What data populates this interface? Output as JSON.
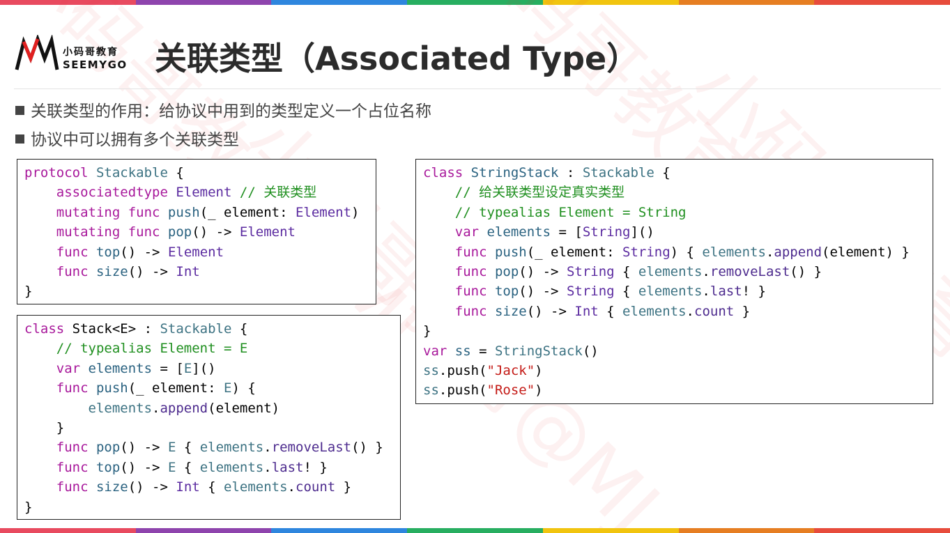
{
  "header": {
    "logo_cn": "小码哥教育",
    "logo_en": "SEEMYGO",
    "title": "关联类型（Associated Type）"
  },
  "bullets": [
    "关联类型的作用：给协议中用到的类型定义一个占位名称",
    "协议中可以拥有多个关联类型"
  ],
  "watermark": "小码哥教育@MJ",
  "colors": {
    "keyword": "#a8189b",
    "type": "#5b2ba0",
    "comment": "#1f8f1f",
    "string": "#c41a16",
    "stripe": [
      "#e84a5f",
      "#8e44ad",
      "#2e86de",
      "#27ae60",
      "#f1c40f",
      "#e67e22",
      "#e74c3c"
    ]
  },
  "code_blocks": {
    "protocol": [
      [
        [
          "protocol ",
          "kw"
        ],
        [
          "Stackable",
          "tn"
        ],
        [
          " {",
          "pl"
        ]
      ],
      [
        [
          "    ",
          "pl"
        ],
        [
          "associatedtype ",
          "kw"
        ],
        [
          "Element",
          "tp"
        ],
        [
          " // 关联类型",
          "cm"
        ]
      ],
      [
        [
          "    ",
          "pl"
        ],
        [
          "mutating func ",
          "kw"
        ],
        [
          "push",
          "fn"
        ],
        [
          "(_ element: ",
          "pl"
        ],
        [
          "Element",
          "tp"
        ],
        [
          ")",
          "pl"
        ]
      ],
      [
        [
          "    ",
          "pl"
        ],
        [
          "mutating func ",
          "kw"
        ],
        [
          "pop",
          "fn"
        ],
        [
          "() -> ",
          "pl"
        ],
        [
          "Element",
          "tp"
        ]
      ],
      [
        [
          "    ",
          "pl"
        ],
        [
          "func ",
          "kw"
        ],
        [
          "top",
          "fn"
        ],
        [
          "() -> ",
          "pl"
        ],
        [
          "Element",
          "tp"
        ]
      ],
      [
        [
          "    ",
          "pl"
        ],
        [
          "func ",
          "kw"
        ],
        [
          "size",
          "fn"
        ],
        [
          "() -> ",
          "pl"
        ],
        [
          "Int",
          "tp"
        ]
      ],
      [
        [
          "}",
          "pl"
        ]
      ]
    ],
    "stack": [
      [
        [
          "class ",
          "kw"
        ],
        [
          "Stack<E>",
          "pl"
        ],
        [
          " : ",
          "pl"
        ],
        [
          "Stackable",
          "tn"
        ],
        [
          " {",
          "pl"
        ]
      ],
      [
        [
          "    // typealias Element = E",
          "cm"
        ]
      ],
      [
        [
          "    ",
          "pl"
        ],
        [
          "var ",
          "kw"
        ],
        [
          "elements",
          "fn"
        ],
        [
          " = [",
          "pl"
        ],
        [
          "E",
          "tn"
        ],
        [
          "]()",
          "pl"
        ]
      ],
      [
        [
          "    ",
          "pl"
        ],
        [
          "func ",
          "kw"
        ],
        [
          "push",
          "fn"
        ],
        [
          "(_ element: ",
          "pl"
        ],
        [
          "E",
          "tn"
        ],
        [
          ") {",
          "pl"
        ]
      ],
      [
        [
          "        ",
          "pl"
        ],
        [
          "elements",
          "tn"
        ],
        [
          ".",
          "pl"
        ],
        [
          "append",
          "mt"
        ],
        [
          "(element)",
          "pl"
        ]
      ],
      [
        [
          "    }",
          "pl"
        ]
      ],
      [
        [
          "    ",
          "pl"
        ],
        [
          "func ",
          "kw"
        ],
        [
          "pop",
          "fn"
        ],
        [
          "() -> ",
          "pl"
        ],
        [
          "E",
          "tn"
        ],
        [
          " { ",
          "pl"
        ],
        [
          "elements",
          "tn"
        ],
        [
          ".",
          "pl"
        ],
        [
          "removeLast",
          "mt"
        ],
        [
          "() }",
          "pl"
        ]
      ],
      [
        [
          "    ",
          "pl"
        ],
        [
          "func ",
          "kw"
        ],
        [
          "top",
          "fn"
        ],
        [
          "() -> ",
          "pl"
        ],
        [
          "E",
          "tn"
        ],
        [
          " { ",
          "pl"
        ],
        [
          "elements",
          "tn"
        ],
        [
          ".",
          "pl"
        ],
        [
          "last",
          "mt"
        ],
        [
          "! }",
          "pl"
        ]
      ],
      [
        [
          "    ",
          "pl"
        ],
        [
          "func ",
          "kw"
        ],
        [
          "size",
          "fn"
        ],
        [
          "() -> ",
          "pl"
        ],
        [
          "Int",
          "tp"
        ],
        [
          " { ",
          "pl"
        ],
        [
          "elements",
          "tn"
        ],
        [
          ".",
          "pl"
        ],
        [
          "count",
          "mt"
        ],
        [
          " }",
          "pl"
        ]
      ],
      [
        [
          "}",
          "pl"
        ]
      ]
    ],
    "stringstack": [
      [
        [
          "class ",
          "kw"
        ],
        [
          "StringStack",
          "fn"
        ],
        [
          " : ",
          "pl"
        ],
        [
          "Stackable",
          "tn"
        ],
        [
          " {",
          "pl"
        ]
      ],
      [
        [
          "    // 给关联类型设定真实类型",
          "cm"
        ]
      ],
      [
        [
          "    // typealias Element = String",
          "cm"
        ]
      ],
      [
        [
          "    ",
          "pl"
        ],
        [
          "var ",
          "kw"
        ],
        [
          "elements",
          "fn"
        ],
        [
          " = [",
          "pl"
        ],
        [
          "String",
          "tp"
        ],
        [
          "]()",
          "pl"
        ]
      ],
      [
        [
          "    ",
          "pl"
        ],
        [
          "func ",
          "kw"
        ],
        [
          "push",
          "fn"
        ],
        [
          "(_ element: ",
          "pl"
        ],
        [
          "String",
          "tp"
        ],
        [
          ") { ",
          "pl"
        ],
        [
          "elements",
          "tn"
        ],
        [
          ".",
          "pl"
        ],
        [
          "append",
          "mt"
        ],
        [
          "(element) }",
          "pl"
        ]
      ],
      [
        [
          "    ",
          "pl"
        ],
        [
          "func ",
          "kw"
        ],
        [
          "pop",
          "fn"
        ],
        [
          "() -> ",
          "pl"
        ],
        [
          "String",
          "tp"
        ],
        [
          " { ",
          "pl"
        ],
        [
          "elements",
          "tn"
        ],
        [
          ".",
          "pl"
        ],
        [
          "removeLast",
          "mt"
        ],
        [
          "() }",
          "pl"
        ]
      ],
      [
        [
          "    ",
          "pl"
        ],
        [
          "func ",
          "kw"
        ],
        [
          "top",
          "fn"
        ],
        [
          "() -> ",
          "pl"
        ],
        [
          "String",
          "tp"
        ],
        [
          " { ",
          "pl"
        ],
        [
          "elements",
          "tn"
        ],
        [
          ".",
          "pl"
        ],
        [
          "last",
          "mt"
        ],
        [
          "! }",
          "pl"
        ]
      ],
      [
        [
          "    ",
          "pl"
        ],
        [
          "func ",
          "kw"
        ],
        [
          "size",
          "fn"
        ],
        [
          "() -> ",
          "pl"
        ],
        [
          "Int",
          "tp"
        ],
        [
          " { ",
          "pl"
        ],
        [
          "elements",
          "tn"
        ],
        [
          ".",
          "pl"
        ],
        [
          "count",
          "mt"
        ],
        [
          " }",
          "pl"
        ]
      ],
      [
        [
          "}",
          "pl"
        ]
      ],
      [
        [
          "var ",
          "kw"
        ],
        [
          "ss",
          "fn"
        ],
        [
          " = ",
          "pl"
        ],
        [
          "StringStack",
          "tn"
        ],
        [
          "()",
          "pl"
        ]
      ],
      [
        [
          "ss",
          "tn"
        ],
        [
          ".push(",
          "pl"
        ],
        [
          "\"Jack\"",
          "st"
        ],
        [
          ")",
          "pl"
        ]
      ],
      [
        [
          "ss",
          "tn"
        ],
        [
          ".push(",
          "pl"
        ],
        [
          "\"Rose\"",
          "st"
        ],
        [
          ")",
          "pl"
        ]
      ]
    ]
  }
}
